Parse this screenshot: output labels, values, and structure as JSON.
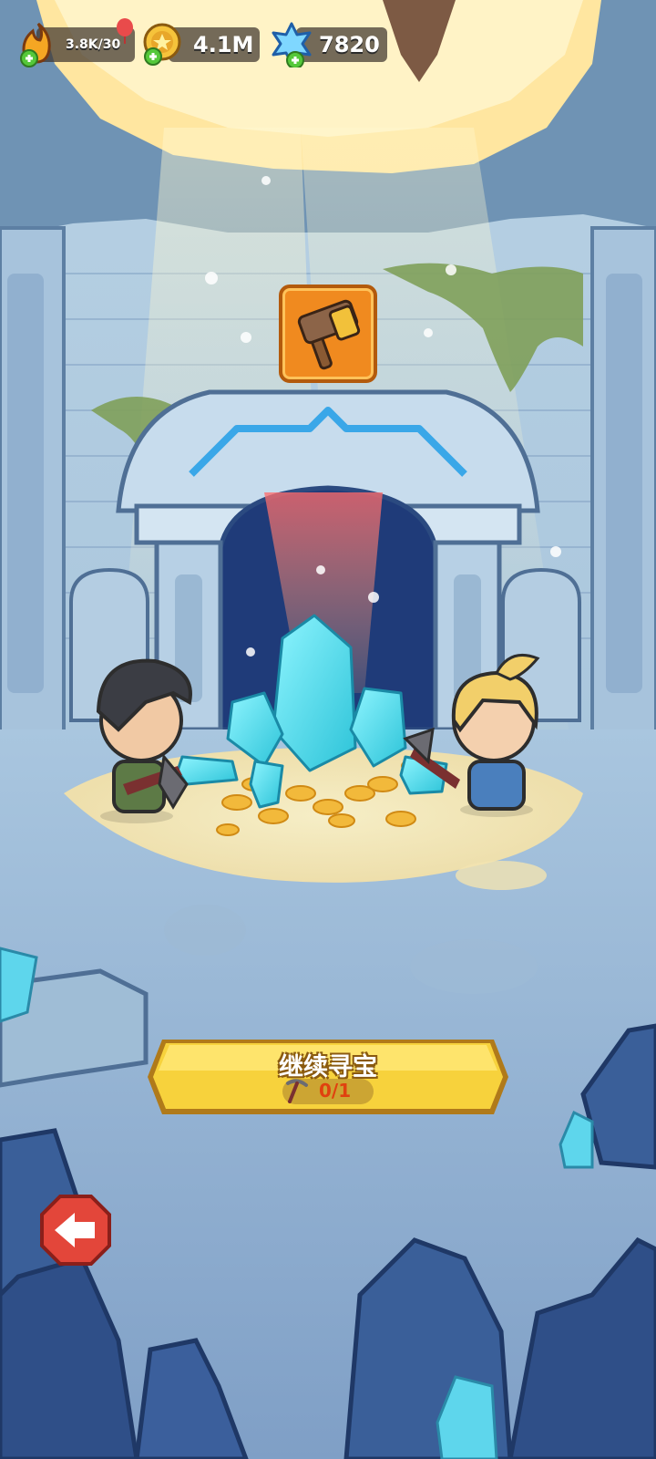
{
  "resources": {
    "energy": {
      "value": "3.8K/30",
      "icon": "flame-icon"
    },
    "gold": {
      "value": "4.1M",
      "icon": "gold-coin-icon"
    },
    "gems": {
      "value": "7820",
      "icon": "blue-crystal-icon"
    }
  },
  "reward": {
    "icon": "hammer-icon"
  },
  "continue_button": {
    "label": "继续寻宝",
    "count": "0/1",
    "count_icon": "pickaxe-icon"
  },
  "back_button": {
    "icon": "back-arrow-icon"
  },
  "colors": {
    "accent_yellow": "#f7d23c",
    "accent_orange": "#f08a1f",
    "back_red": "#e3463a",
    "count_red": "#e0410f"
  }
}
